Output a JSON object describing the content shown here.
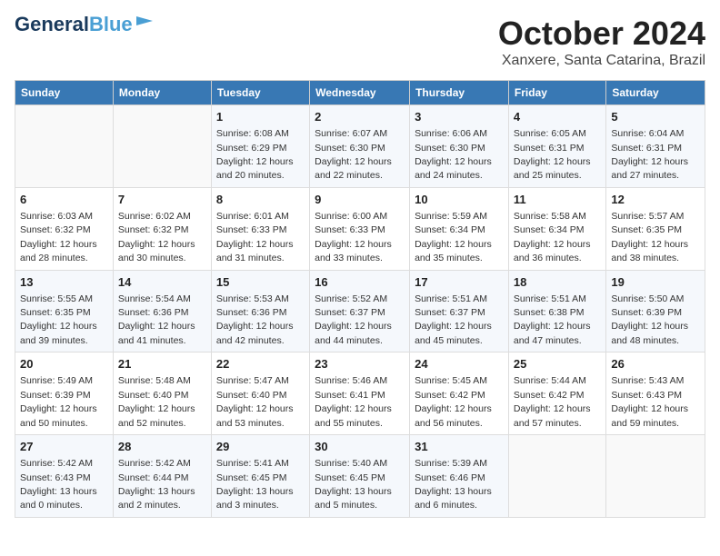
{
  "header": {
    "logo_line1": "General",
    "logo_line2": "Blue",
    "month": "October 2024",
    "location": "Xanxere, Santa Catarina, Brazil"
  },
  "days_of_week": [
    "Sunday",
    "Monday",
    "Tuesday",
    "Wednesday",
    "Thursday",
    "Friday",
    "Saturday"
  ],
  "weeks": [
    [
      {
        "day": null,
        "info": null
      },
      {
        "day": null,
        "info": null
      },
      {
        "day": "1",
        "sunrise": "6:08 AM",
        "sunset": "6:29 PM",
        "daylight": "12 hours and 20 minutes."
      },
      {
        "day": "2",
        "sunrise": "6:07 AM",
        "sunset": "6:30 PM",
        "daylight": "12 hours and 22 minutes."
      },
      {
        "day": "3",
        "sunrise": "6:06 AM",
        "sunset": "6:30 PM",
        "daylight": "12 hours and 24 minutes."
      },
      {
        "day": "4",
        "sunrise": "6:05 AM",
        "sunset": "6:31 PM",
        "daylight": "12 hours and 25 minutes."
      },
      {
        "day": "5",
        "sunrise": "6:04 AM",
        "sunset": "6:31 PM",
        "daylight": "12 hours and 27 minutes."
      }
    ],
    [
      {
        "day": "6",
        "sunrise": "6:03 AM",
        "sunset": "6:32 PM",
        "daylight": "12 hours and 28 minutes."
      },
      {
        "day": "7",
        "sunrise": "6:02 AM",
        "sunset": "6:32 PM",
        "daylight": "12 hours and 30 minutes."
      },
      {
        "day": "8",
        "sunrise": "6:01 AM",
        "sunset": "6:33 PM",
        "daylight": "12 hours and 31 minutes."
      },
      {
        "day": "9",
        "sunrise": "6:00 AM",
        "sunset": "6:33 PM",
        "daylight": "12 hours and 33 minutes."
      },
      {
        "day": "10",
        "sunrise": "5:59 AM",
        "sunset": "6:34 PM",
        "daylight": "12 hours and 35 minutes."
      },
      {
        "day": "11",
        "sunrise": "5:58 AM",
        "sunset": "6:34 PM",
        "daylight": "12 hours and 36 minutes."
      },
      {
        "day": "12",
        "sunrise": "5:57 AM",
        "sunset": "6:35 PM",
        "daylight": "12 hours and 38 minutes."
      }
    ],
    [
      {
        "day": "13",
        "sunrise": "5:55 AM",
        "sunset": "6:35 PM",
        "daylight": "12 hours and 39 minutes."
      },
      {
        "day": "14",
        "sunrise": "5:54 AM",
        "sunset": "6:36 PM",
        "daylight": "12 hours and 41 minutes."
      },
      {
        "day": "15",
        "sunrise": "5:53 AM",
        "sunset": "6:36 PM",
        "daylight": "12 hours and 42 minutes."
      },
      {
        "day": "16",
        "sunrise": "5:52 AM",
        "sunset": "6:37 PM",
        "daylight": "12 hours and 44 minutes."
      },
      {
        "day": "17",
        "sunrise": "5:51 AM",
        "sunset": "6:37 PM",
        "daylight": "12 hours and 45 minutes."
      },
      {
        "day": "18",
        "sunrise": "5:51 AM",
        "sunset": "6:38 PM",
        "daylight": "12 hours and 47 minutes."
      },
      {
        "day": "19",
        "sunrise": "5:50 AM",
        "sunset": "6:39 PM",
        "daylight": "12 hours and 48 minutes."
      }
    ],
    [
      {
        "day": "20",
        "sunrise": "5:49 AM",
        "sunset": "6:39 PM",
        "daylight": "12 hours and 50 minutes."
      },
      {
        "day": "21",
        "sunrise": "5:48 AM",
        "sunset": "6:40 PM",
        "daylight": "12 hours and 52 minutes."
      },
      {
        "day": "22",
        "sunrise": "5:47 AM",
        "sunset": "6:40 PM",
        "daylight": "12 hours and 53 minutes."
      },
      {
        "day": "23",
        "sunrise": "5:46 AM",
        "sunset": "6:41 PM",
        "daylight": "12 hours and 55 minutes."
      },
      {
        "day": "24",
        "sunrise": "5:45 AM",
        "sunset": "6:42 PM",
        "daylight": "12 hours and 56 minutes."
      },
      {
        "day": "25",
        "sunrise": "5:44 AM",
        "sunset": "6:42 PM",
        "daylight": "12 hours and 57 minutes."
      },
      {
        "day": "26",
        "sunrise": "5:43 AM",
        "sunset": "6:43 PM",
        "daylight": "12 hours and 59 minutes."
      }
    ],
    [
      {
        "day": "27",
        "sunrise": "5:42 AM",
        "sunset": "6:43 PM",
        "daylight": "13 hours and 0 minutes."
      },
      {
        "day": "28",
        "sunrise": "5:42 AM",
        "sunset": "6:44 PM",
        "daylight": "13 hours and 2 minutes."
      },
      {
        "day": "29",
        "sunrise": "5:41 AM",
        "sunset": "6:45 PM",
        "daylight": "13 hours and 3 minutes."
      },
      {
        "day": "30",
        "sunrise": "5:40 AM",
        "sunset": "6:45 PM",
        "daylight": "13 hours and 5 minutes."
      },
      {
        "day": "31",
        "sunrise": "5:39 AM",
        "sunset": "6:46 PM",
        "daylight": "13 hours and 6 minutes."
      },
      {
        "day": null,
        "info": null
      },
      {
        "day": null,
        "info": null
      }
    ]
  ],
  "labels": {
    "sunrise": "Sunrise:",
    "sunset": "Sunset:",
    "daylight": "Daylight:"
  }
}
